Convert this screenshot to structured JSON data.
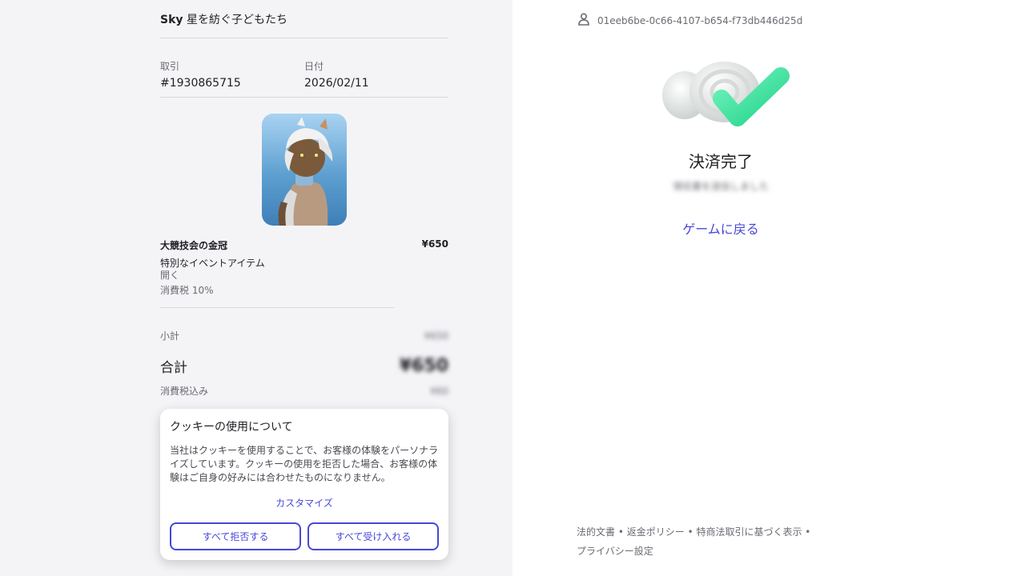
{
  "order": {
    "game_title_bold": "Sky",
    "game_title_rest": " 星を紡ぐ子どもたち",
    "transaction_label": "取引",
    "transaction_value": "#1930865715",
    "date_label": "日付",
    "date_value": "2026/02/11"
  },
  "item": {
    "name": "大競技会の金冠",
    "price": "¥650",
    "subtitle": "特別なイベントアイテム",
    "open_label": "開く",
    "tax_note": "消費税 10%"
  },
  "summary": {
    "subtotal_label": "小計",
    "subtotal_value": "¥650",
    "total_label": "合計",
    "total_value": "¥650",
    "tax_included_label": "消費税込み",
    "tax_included_value": "¥60"
  },
  "cookie": {
    "title": "クッキーの使用について",
    "body": "当社はクッキーを使用することで、お客様の体験をパーソナライズしています。クッキーの使用を拒否した場合、お客様の体験はご自身の好みには合わせたものになりません。",
    "customize": "カスタマイズ",
    "reject_all": "すべて拒否する",
    "accept_all": "すべて受け入れる"
  },
  "account": {
    "user_id": "01eeb6be-0c66-4107-b654-f73db446d25d",
    "icon": "user-icon"
  },
  "result": {
    "title": "決済完了",
    "subtitle": "領収書を送信しました",
    "back_link": "ゲームに戻る"
  },
  "footer": {
    "legal": "法的文書",
    "refund": "返金ポリシー",
    "commerce": "特商法取引に基づく表示",
    "privacy": "プライバシー設定",
    "separator": " • "
  },
  "colors": {
    "accent": "#4747d9",
    "check_green": "#3ee8a0",
    "left_bg": "#f4f4f7"
  }
}
